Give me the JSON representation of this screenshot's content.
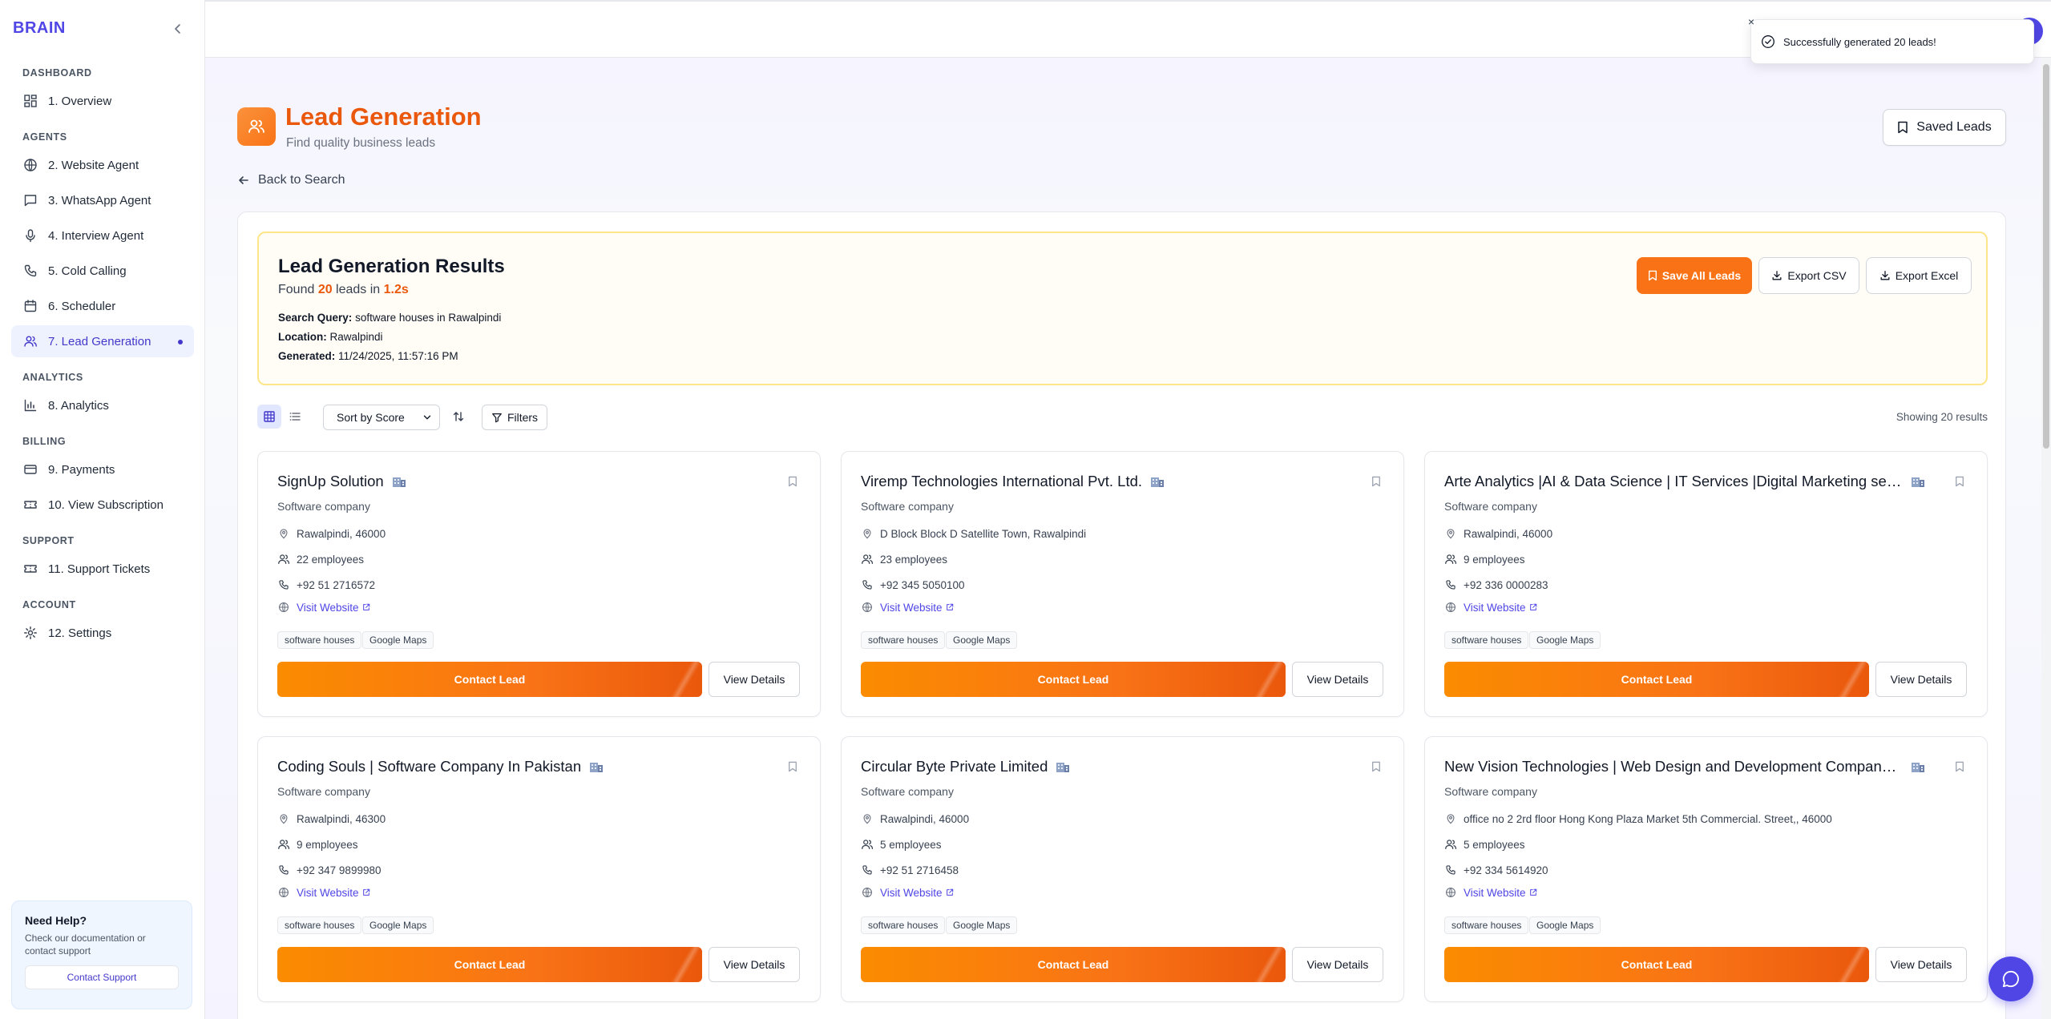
{
  "brand": "BRAIN",
  "sidebar": {
    "sections": [
      {
        "title": "DASHBOARD",
        "items": [
          {
            "label": "1. Overview",
            "icon": "grid-icon"
          }
        ]
      },
      {
        "title": "AGENTS",
        "items": [
          {
            "label": "2. Website Agent",
            "icon": "globe-icon"
          },
          {
            "label": "3. WhatsApp Agent",
            "icon": "message-icon"
          },
          {
            "label": "4. Interview Agent",
            "icon": "mic-icon"
          },
          {
            "label": "5. Cold Calling",
            "icon": "phone-icon"
          },
          {
            "label": "6. Scheduler",
            "icon": "calendar-icon"
          },
          {
            "label": "7. Lead Generation",
            "icon": "users-icon",
            "active": true
          }
        ]
      },
      {
        "title": "ANALYTICS",
        "items": [
          {
            "label": "8. Analytics",
            "icon": "bar-chart-icon"
          }
        ]
      },
      {
        "title": "BILLING",
        "items": [
          {
            "label": "9. Payments",
            "icon": "credit-card-icon"
          },
          {
            "label": "10. View Subscription",
            "icon": "ticket-icon"
          }
        ]
      },
      {
        "title": "SUPPORT",
        "items": [
          {
            "label": "11. Support Tickets",
            "icon": "ticket-icon"
          }
        ]
      },
      {
        "title": "ACCOUNT",
        "items": [
          {
            "label": "12. Settings",
            "icon": "gear-icon"
          }
        ]
      }
    ],
    "help": {
      "title": "Need Help?",
      "text": "Check our documentation or contact support",
      "button": "Contact Support"
    }
  },
  "toast": {
    "message": "Successfully generated 20 leads!",
    "close": "×"
  },
  "page": {
    "title": "Lead Generation",
    "subtitle": "Find quality business leads",
    "saved_leads": "Saved Leads",
    "back": "Back to Search"
  },
  "results": {
    "title": "Lead Generation Results",
    "found_prefix": "Found ",
    "count": "20",
    "found_mid": " leads in ",
    "time": "1.2s",
    "query_label": "Search Query:",
    "query": "software houses in Rawalpindi",
    "location_label": "Location:",
    "location": "Rawalpindi",
    "generated_label": "Generated:",
    "generated": "11/24/2025, 11:57:16 PM",
    "save_all": "Save All Leads",
    "export_csv": "Export CSV",
    "export_excel": "Export Excel"
  },
  "toolbar": {
    "sort": "Sort by Score",
    "filters": "Filters",
    "showing": "Showing 20 results"
  },
  "leads": [
    {
      "name": "SignUp Solution",
      "type": "Software company",
      "address": "Rawalpindi, 46000",
      "employees": "22 employees",
      "phone": "+92 51 2716572",
      "website": "Visit Website",
      "tags": [
        "software houses",
        "Google Maps"
      ]
    },
    {
      "name": "Viremp Technologies International Pvt. Ltd.",
      "type": "Software company",
      "address": "D Block Block D Satellite Town, Rawalpindi",
      "employees": "23 employees",
      "phone": "+92 345 5050100",
      "website": "Visit Website",
      "tags": [
        "software houses",
        "Google Maps"
      ]
    },
    {
      "name": "Arte Analytics |AI & Data Science | IT Services |Digital Marketing servi...",
      "type": "Software company",
      "address": "Rawalpindi, 46000",
      "employees": "9 employees",
      "phone": "+92 336 0000283",
      "website": "Visit Website",
      "tags": [
        "software houses",
        "Google Maps"
      ]
    },
    {
      "name": "Coding Souls | Software Company In Pakistan",
      "type": "Software company",
      "address": "Rawalpindi, 46300",
      "employees": "9 employees",
      "phone": "+92 347 9899980",
      "website": "Visit Website",
      "tags": [
        "software houses",
        "Google Maps"
      ]
    },
    {
      "name": "Circular Byte Private Limited",
      "type": "Software company",
      "address": "Rawalpindi, 46000",
      "employees": "5 employees",
      "phone": "+92 51 2716458",
      "website": "Visit Website",
      "tags": [
        "software houses",
        "Google Maps"
      ]
    },
    {
      "name": "New Vision Technologies | Web Design and Development Company in...",
      "type": "Software company",
      "address": "office no 2 2rd floor Hong Kong Plaza Market 5th Commercial. Street,, 46000",
      "employees": "5 employees",
      "phone": "+92 334 5614920",
      "website": "Visit Website",
      "tags": [
        "software houses",
        "Google Maps"
      ]
    }
  ],
  "card_actions": {
    "contact": "Contact Lead",
    "details": "View Details"
  },
  "colors": {
    "brand": "#4f46e5",
    "accent": "#f97316",
    "title": "#ea580c"
  }
}
